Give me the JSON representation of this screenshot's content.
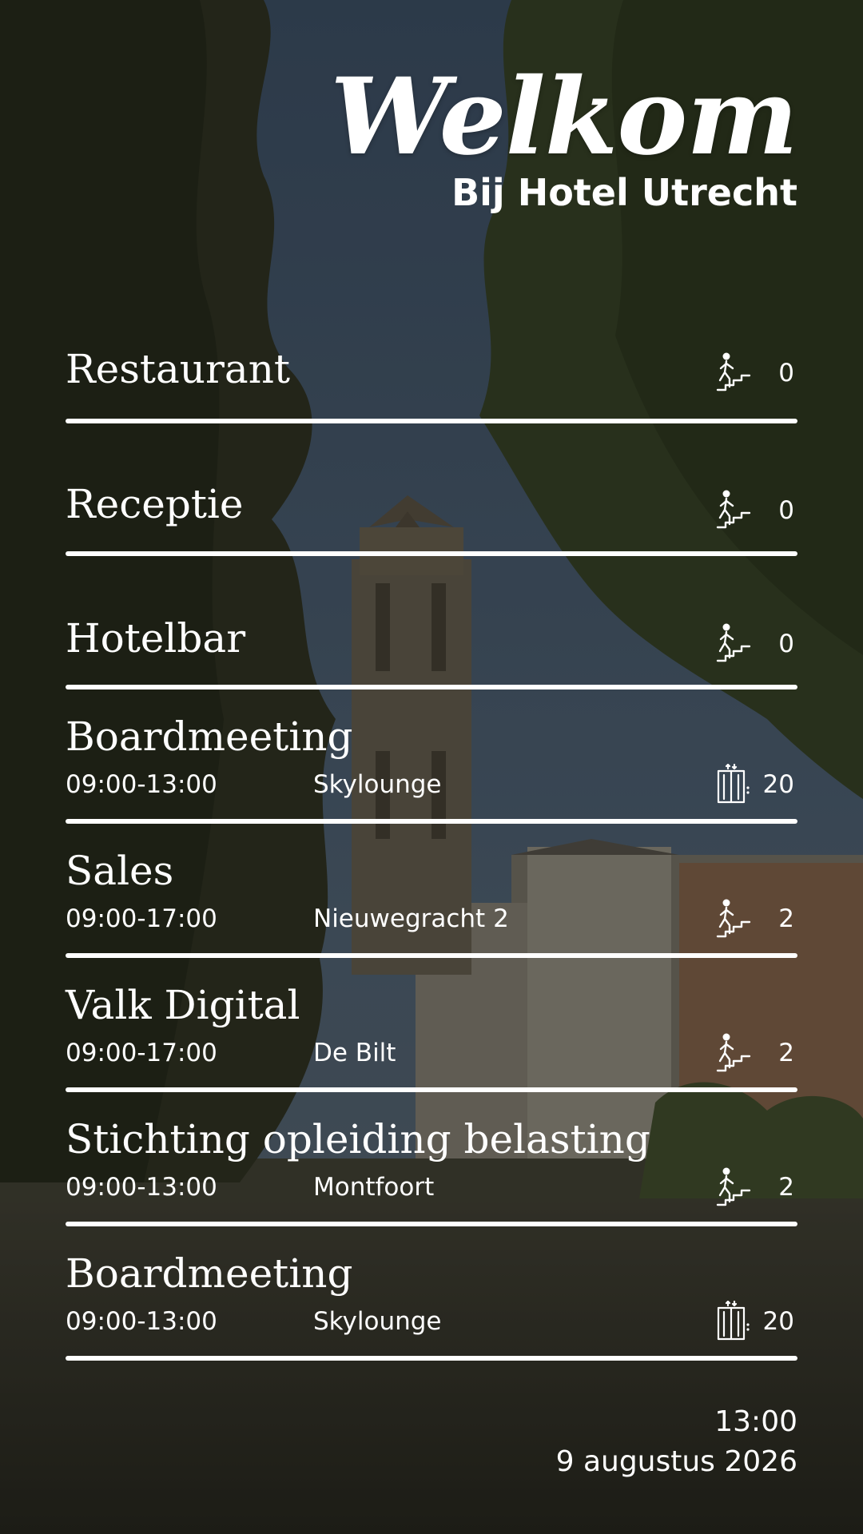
{
  "header": {
    "title": "Welkom",
    "subtitle": "Bij Hotel Utrecht"
  },
  "rows": [
    {
      "title": "Restaurant",
      "time": "",
      "location": "",
      "icon": "stairs-icon",
      "count": "0"
    },
    {
      "title": "Receptie",
      "time": "",
      "location": "",
      "icon": "stairs-icon",
      "count": "0"
    },
    {
      "title": "Hotelbar",
      "time": "",
      "location": "",
      "icon": "stairs-icon",
      "count": "0"
    },
    {
      "title": "Boardmeeting",
      "time": "09:00-13:00",
      "location": "Skylounge",
      "icon": "elevator-icon",
      "count": "20"
    },
    {
      "title": "Sales",
      "time": "09:00-17:00",
      "location": "Nieuwegracht 2",
      "icon": "stairs-icon",
      "count": "2"
    },
    {
      "title": "Valk Digital",
      "time": "09:00-17:00",
      "location": "De Bilt",
      "icon": "stairs-icon",
      "count": "2"
    },
    {
      "title": "Stichting opleiding belasting",
      "time": "09:00-13:00",
      "location": "Montfoort",
      "icon": "stairs-icon",
      "count": "2"
    },
    {
      "title": "Boardmeeting",
      "time": "09:00-13:00",
      "location": "Skylounge",
      "icon": "elevator-icon",
      "count": "20"
    }
  ],
  "footer": {
    "time": "13:00",
    "date": "9 augustus 2026"
  }
}
